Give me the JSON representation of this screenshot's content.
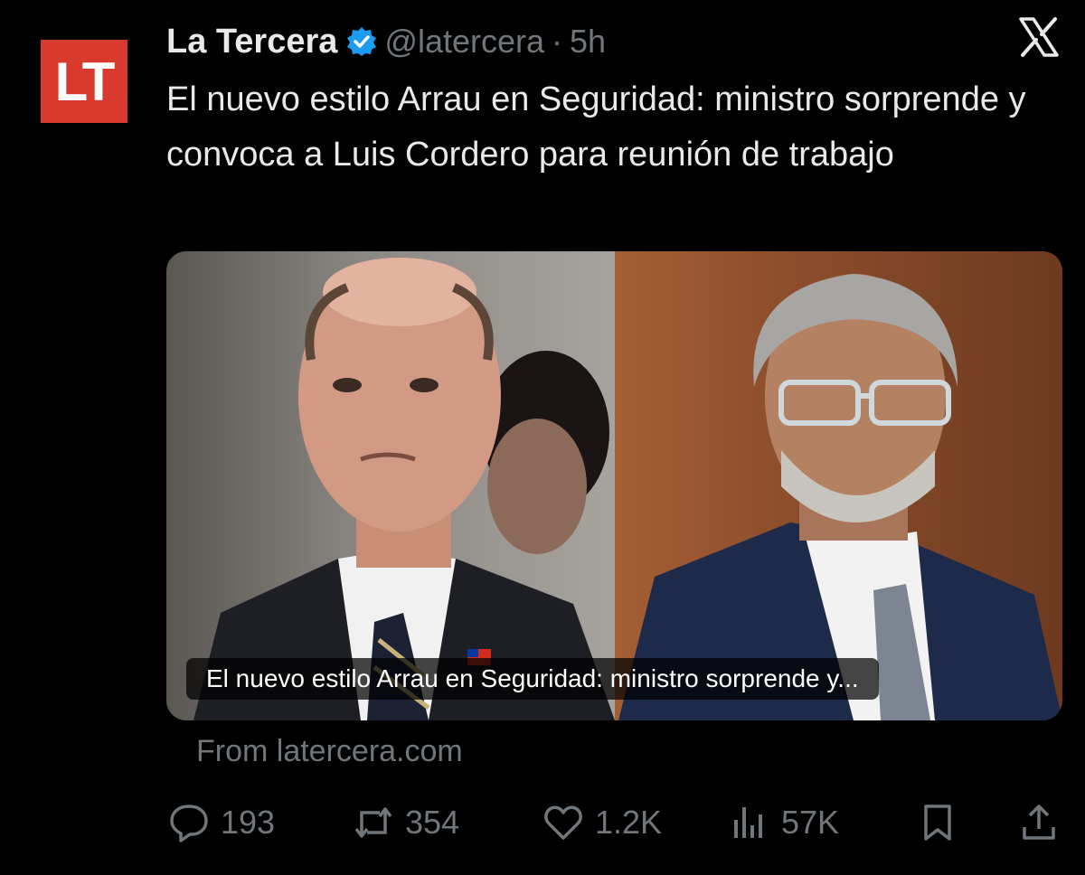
{
  "tweet": {
    "author_name": "La Tercera",
    "handle": "@latercera",
    "separator": "·",
    "time": "5h",
    "avatar_text": "LT",
    "text": "El nuevo estilo Arrau en Seguridad: ministro sorprende y convoca a Luis Cordero para reunión de trabajo"
  },
  "card": {
    "caption": "El nuevo estilo Arrau en Seguridad: ministro sorprende y...",
    "source": "From latercera.com"
  },
  "actions": {
    "replies": "193",
    "reposts": "354",
    "likes": "1.2K",
    "views": "57K"
  },
  "colors": {
    "background": "#000000",
    "text": "#e7e9ea",
    "muted": "#71767b",
    "verified": "#1d9bf0",
    "avatar_bg": "#d93a2e"
  },
  "icons": [
    "x-logo-icon",
    "verified-badge-icon",
    "reply-icon",
    "repost-icon",
    "like-icon",
    "views-icon",
    "bookmark-icon",
    "share-icon"
  ]
}
